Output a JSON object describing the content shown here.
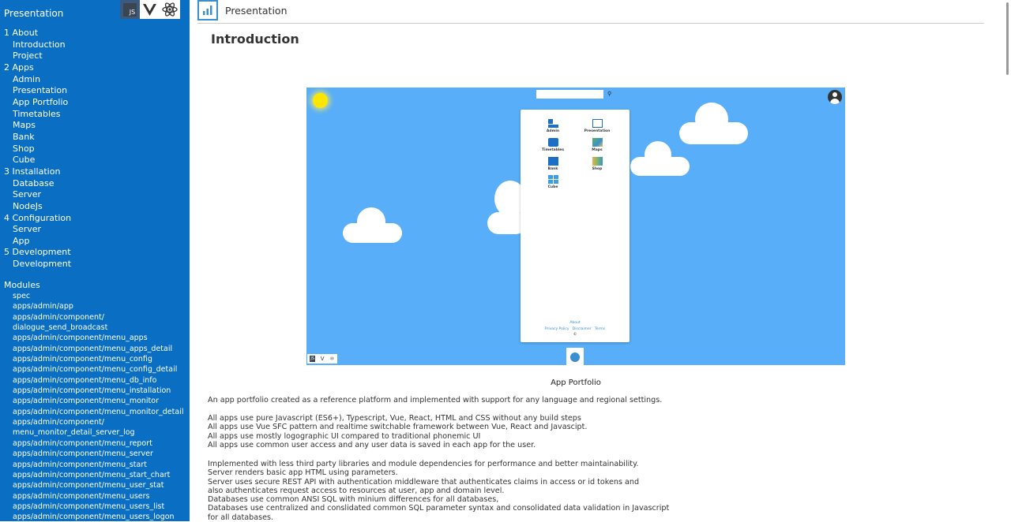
{
  "sidebar": {
    "title": "Presentation",
    "frameworks": [
      "JS",
      "V",
      "⚛"
    ],
    "toc": [
      {
        "label": "1 About",
        "level": 0
      },
      {
        "label": "Introduction",
        "level": 1
      },
      {
        "label": "Project",
        "level": 1
      },
      {
        "label": "2 Apps",
        "level": 0
      },
      {
        "label": "Admin",
        "level": 1
      },
      {
        "label": "Presentation",
        "level": 1
      },
      {
        "label": "App Portfolio",
        "level": 1
      },
      {
        "label": "Timetables",
        "level": 1
      },
      {
        "label": "Maps",
        "level": 1
      },
      {
        "label": "Bank",
        "level": 1
      },
      {
        "label": "Shop",
        "level": 1
      },
      {
        "label": "Cube",
        "level": 1
      },
      {
        "label": "3 Installation",
        "level": 0
      },
      {
        "label": "Database",
        "level": 1
      },
      {
        "label": "Server",
        "level": 1
      },
      {
        "label": "NodeJs",
        "level": 1
      },
      {
        "label": "4 Configuration",
        "level": 0
      },
      {
        "label": "Server",
        "level": 1
      },
      {
        "label": "App",
        "level": 1
      },
      {
        "label": "5 Development",
        "level": 0
      },
      {
        "label": "Development",
        "level": 1
      }
    ],
    "modules_title": "Modules",
    "modules": [
      "spec",
      "apps/admin/app",
      "apps/admin/component/",
      "dialogue_send_broadcast",
      "apps/admin/component/menu_apps",
      "apps/admin/component/menu_apps_detail",
      "apps/admin/component/menu_config",
      "apps/admin/component/menu_config_detail",
      "apps/admin/component/menu_db_info",
      "apps/admin/component/menu_installation",
      "apps/admin/component/menu_monitor",
      "apps/admin/component/menu_monitor_detail",
      "apps/admin/component/",
      "menu_monitor_detail_server_log",
      "apps/admin/component/menu_report",
      "apps/admin/component/menu_server",
      "apps/admin/component/menu_start",
      "apps/admin/component/menu_start_chart",
      "apps/admin/component/menu_user_stat",
      "apps/admin/component/menu_users",
      "apps/admin/component/menu_users_list",
      "apps/admin/component/menu_users_logon"
    ]
  },
  "header": {
    "app_name": "Presentation"
  },
  "page": {
    "title": "Introduction",
    "image_caption": "App Portfolio",
    "screenshot": {
      "tiles": [
        {
          "label": "Admin",
          "icon": "admin-icon"
        },
        {
          "label": "Presentation",
          "icon": "presentation-icon"
        },
        {
          "label": "Timetables",
          "icon": "timetables-icon"
        },
        {
          "label": "Maps",
          "icon": "maps-icon"
        },
        {
          "label": "Bank",
          "icon": "bank-icon"
        },
        {
          "label": "Shop",
          "icon": "shop-icon"
        },
        {
          "label": "Cube",
          "icon": "cube-icon"
        }
      ],
      "footer_label": "About",
      "footer_links": [
        "Privacy Policy",
        "Disclaimer",
        "Terms"
      ],
      "copyright": "©"
    },
    "paragraphs": [
      [
        "An app portfolio created as a reference platform and implemented with support for any language and regional settings."
      ],
      [
        "All apps use pure Javascript (ES6+), Typescript, Vue, React, HTML and CSS without any build steps",
        "All apps use Vue SFC pattern and realtime switchable framework between Vue, React and Javascipt.",
        "All apps use mostly logographic UI compared to traditional phonemic UI",
        "All apps use common user access and any user data is saved in each app for the user."
      ],
      [
        "Implemented with less third party libraries and module dependencies for performance and better maintainability.",
        "Server renders basic app HTML using parameters.",
        "Server uses secure REST API with authentication middleware that authenticates claims in access or id tokens and",
        "also authenticates request access to resources at user, app and domain level.",
        "Databases use common ANSI SQL with minium differences for all databases,",
        "Databases use centralized and conslidated common SQL parameter syntax and consolidated data validation in Javascript",
        "for all databases."
      ]
    ]
  },
  "colors": {
    "sidebar": "#0a6fc2",
    "sky": "#58aef8",
    "sun": "#ffe600",
    "accent": "#3a8fd0"
  }
}
